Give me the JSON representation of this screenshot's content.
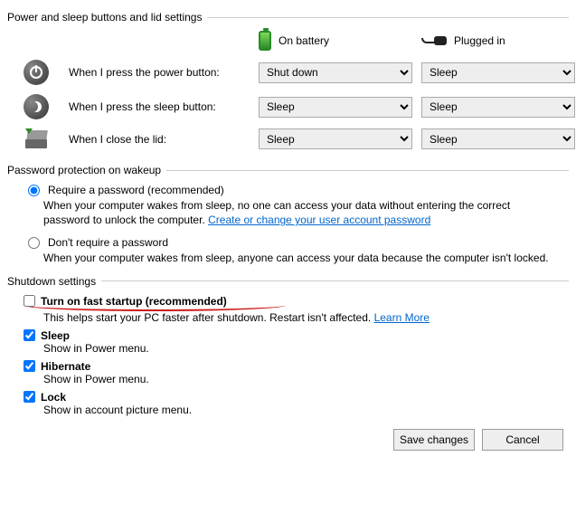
{
  "sections": {
    "buttons_lid": "Power and sleep buttons and lid settings",
    "password": "Password protection on wakeup",
    "shutdown": "Shutdown settings"
  },
  "columns": {
    "battery": "On battery",
    "plugged": "Plugged in"
  },
  "rows": {
    "power": {
      "label": "When I press the power button:",
      "battery": "Shut down",
      "plugged": "Sleep"
    },
    "sleep": {
      "label": "When I press the sleep button:",
      "battery": "Sleep",
      "plugged": "Sleep"
    },
    "lid": {
      "label": "When I close the lid:",
      "battery": "Sleep",
      "plugged": "Sleep"
    }
  },
  "pw": {
    "require_label": "Require a password (recommended)",
    "require_desc": "When your computer wakes from sleep, no one can access your data without entering the correct password to unlock the computer. ",
    "require_link": "Create or change your user account password",
    "dont_label": "Don't require a password",
    "dont_desc": "When your computer wakes from sleep, anyone can access your data because the computer isn't locked.",
    "selected": "require"
  },
  "shutdown": {
    "fast": {
      "label": "Turn on fast startup (recommended)",
      "desc_pre": "This helps start your PC faster after shutdown. Restart isn't affected. ",
      "link": "Learn More",
      "checked": false
    },
    "sleep": {
      "label": "Sleep",
      "desc": "Show in Power menu.",
      "checked": true
    },
    "hibernate": {
      "label": "Hibernate",
      "desc": "Show in Power menu.",
      "checked": true
    },
    "lock": {
      "label": "Lock",
      "desc": "Show in account picture menu.",
      "checked": true
    }
  },
  "buttons": {
    "save": "Save changes",
    "cancel": "Cancel"
  }
}
